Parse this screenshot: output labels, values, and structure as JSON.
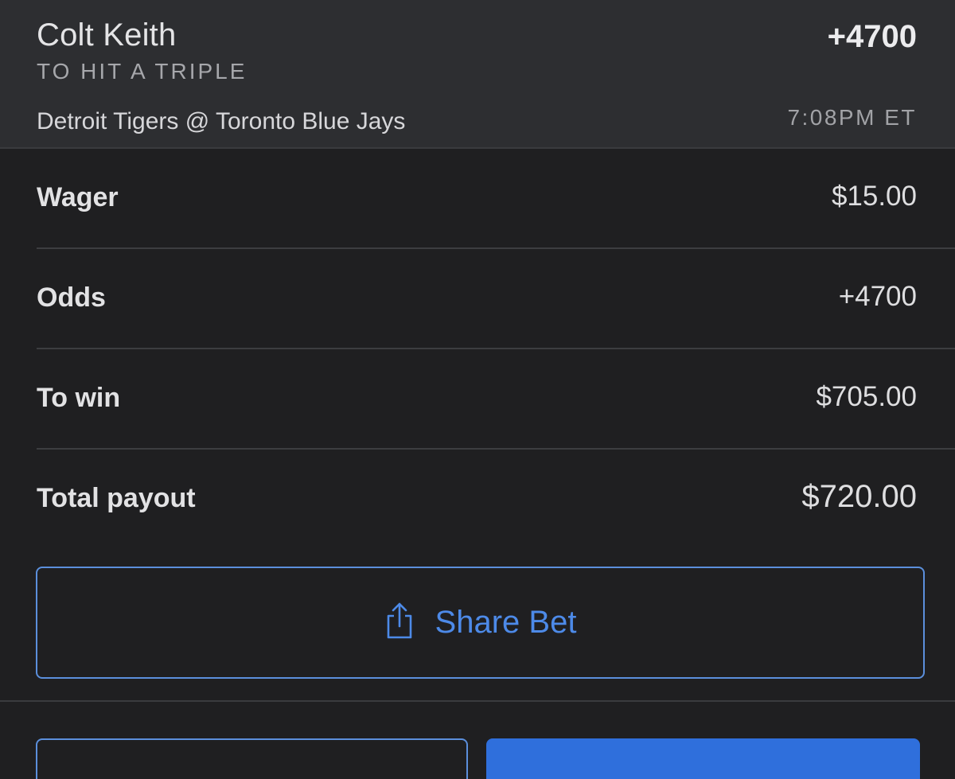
{
  "bet": {
    "player": "Colt Keith",
    "market": "TO HIT A TRIPLE",
    "odds": "+4700",
    "matchup": "Detroit Tigers @ Toronto Blue Jays",
    "time": "7:08PM ET"
  },
  "details": [
    {
      "label": "Wager",
      "value": "$15.00"
    },
    {
      "label": "Odds",
      "value": "+4700"
    },
    {
      "label": "To win",
      "value": "$705.00"
    },
    {
      "label": "Total payout",
      "value": "$720.00"
    }
  ],
  "share": {
    "label": "Share Bet",
    "icon": "share-icon"
  },
  "colors": {
    "accent": "#4d8ae8",
    "primary_button": "#2f6fdc",
    "background": "#1f1f21",
    "header_background": "#2d2e31"
  }
}
